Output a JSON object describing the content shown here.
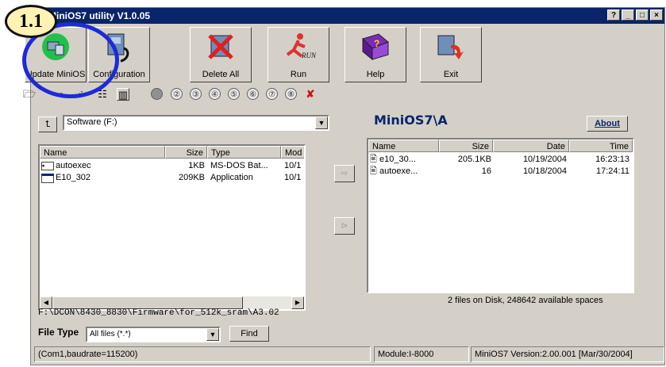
{
  "window": {
    "title": "MiniOS7 utility V1.0.05",
    "controls": [
      "?",
      "_",
      "□",
      "×"
    ]
  },
  "callout": {
    "label": "1.1"
  },
  "toolbar": {
    "buttons": [
      {
        "label": "Update MiniOS"
      },
      {
        "label": "Configuration"
      },
      {
        "label": "Delete All"
      },
      {
        "label": "Run"
      },
      {
        "label": "Help"
      },
      {
        "label": "Exit"
      }
    ],
    "com_ports": [
      "②",
      "③",
      "④",
      "⑤",
      "⑥",
      "⑦",
      "⑧"
    ]
  },
  "local_panel": {
    "drive_selected": "Software (F:)",
    "columns": [
      "Name",
      "Size",
      "Type",
      "Mod"
    ],
    "rows": [
      {
        "name": "autoexec",
        "size": "1KB",
        "type": "MS-DOS Bat...",
        "mod": "10/1"
      },
      {
        "name": "E10_302",
        "size": "209KB",
        "type": "Application",
        "mod": "10/1"
      }
    ],
    "path": "F:\\DCON\\8430_8830\\Firmware\\for_512k_sram\\A3.02",
    "file_type_label": "File Type",
    "file_type_value": "All files (*.*)",
    "find_label": "Find"
  },
  "remote_panel": {
    "title": "MiniOS7\\A",
    "about_label": "About",
    "columns": [
      "Name",
      "Size",
      "Date",
      "Time"
    ],
    "rows": [
      {
        "name": "e10_30...",
        "size": "205.1KB",
        "date": "10/19/2004",
        "time": "16:23:13"
      },
      {
        "name": "autoexe...",
        "size": "16",
        "date": "10/18/2004",
        "time": "17:24:11"
      }
    ],
    "disk_info": "2 files on Disk,  248642 available spaces"
  },
  "status": {
    "com": "(Com1,baudrate=115200)",
    "module": "Module:I-8000",
    "version": "MiniOS7 Version:2.00.001 [Mar/30/2004]"
  },
  "colors": {
    "titlebar": "#0a246a",
    "remote_title": "#0a246a",
    "callout_fill": "#fff2b3",
    "callout_ring": "#1c2bd8"
  }
}
